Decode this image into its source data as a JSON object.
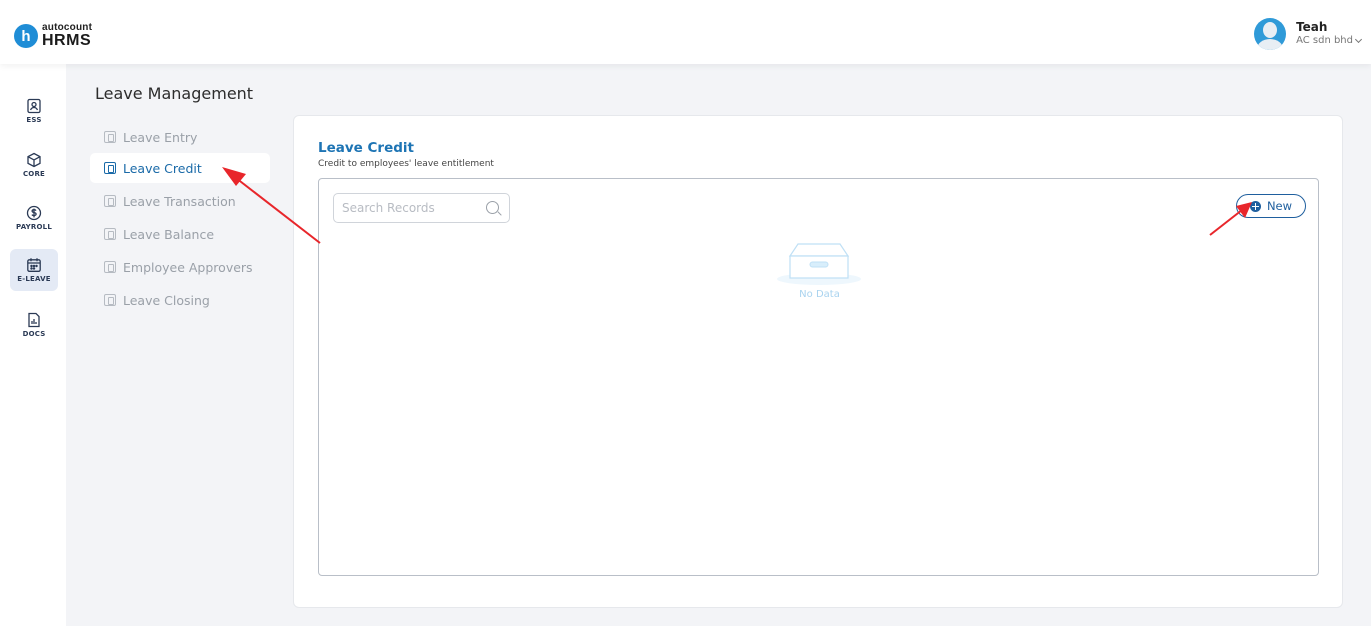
{
  "app": {
    "logo_small": "autocount",
    "logo_big": "HRMS",
    "logo_badge": "h"
  },
  "user": {
    "name": "Teah",
    "company": "AC sdn bhd"
  },
  "rail": [
    {
      "label": "ESS",
      "icon": "ess-icon"
    },
    {
      "label": "CORE",
      "icon": "cube-icon"
    },
    {
      "label": "PAYROLL",
      "icon": "dollar-icon"
    },
    {
      "label": "E-LEAVE",
      "icon": "calendar-icon",
      "active": true
    },
    {
      "label": "DOCS",
      "icon": "docs-icon"
    }
  ],
  "section": {
    "title": "Leave Management"
  },
  "submenu": [
    {
      "label": "Leave Entry"
    },
    {
      "label": "Leave Credit",
      "active": true
    },
    {
      "label": "Leave Transaction"
    },
    {
      "label": "Leave Balance"
    },
    {
      "label": "Employee Approvers"
    },
    {
      "label": "Leave Closing"
    }
  ],
  "card": {
    "title": "Leave Credit",
    "subtitle": "Credit to employees' leave entitlement",
    "search_placeholder": "Search Records",
    "new_label": "New",
    "empty_text": "No Data"
  },
  "colors": {
    "accent": "#1d74b4",
    "button": "#1f5f9e",
    "annotation_arrow": "#e8262b"
  }
}
